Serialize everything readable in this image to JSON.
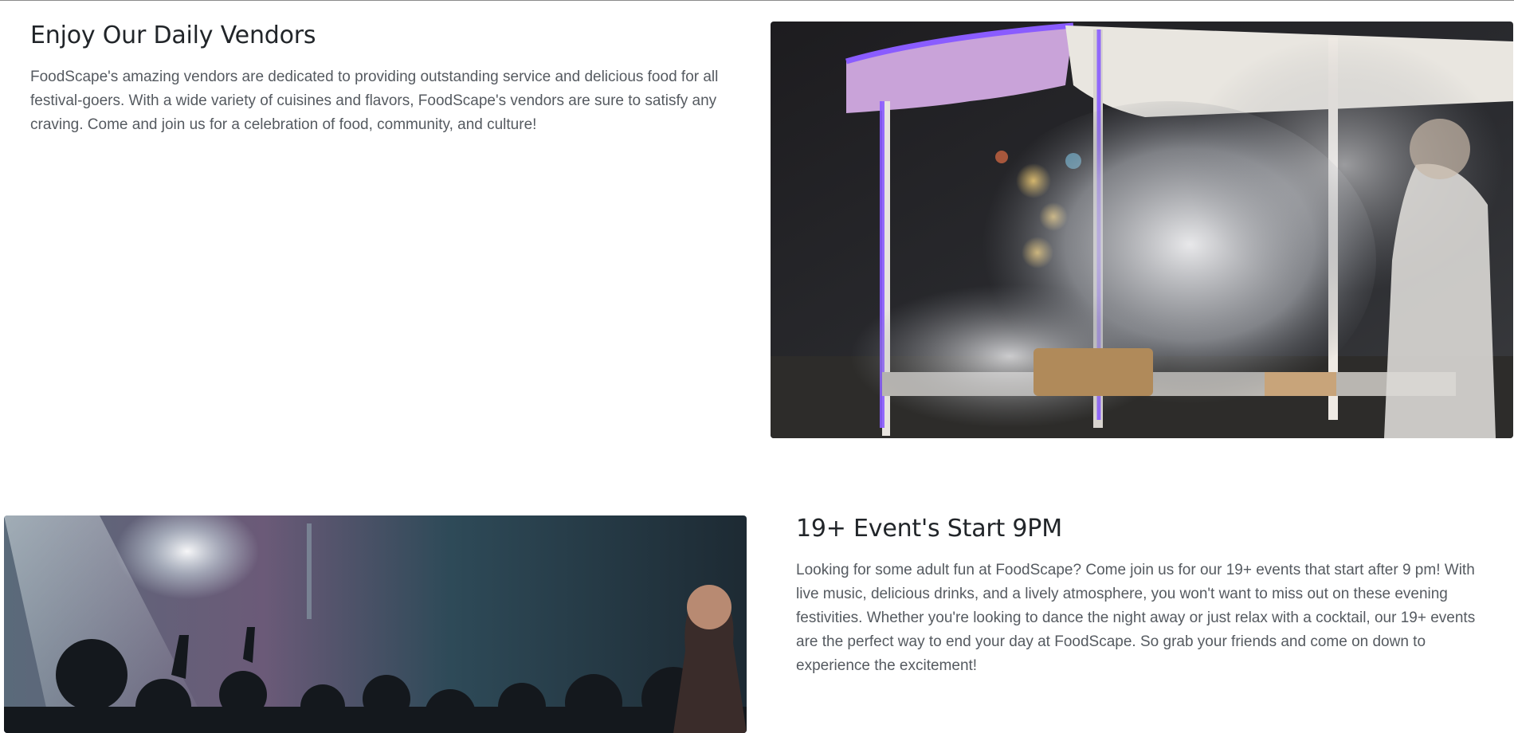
{
  "vendors": {
    "heading": "Enjoy Our Daily Vendors",
    "body": "FoodScape's amazing vendors are dedicated to providing outstanding service and delicious food for all festival-goers. With a wide variety of cuisines and flavors, FoodScape's vendors are sure to satisfy any craving. Come and join us for a celebration of food, community, and culture!",
    "image_icon": "food-cart-photo-icon"
  },
  "events": {
    "heading": "19+ Event's Start 9PM",
    "body": "Looking for some adult fun at FoodScape? Come join us for our 19+ events that start after 9 pm! With live music, delicious drinks, and a lively atmosphere, you won't want to miss out on these evening festivities. Whether you're looking to dance the night away or just relax with a cocktail, our 19+ events are the perfect way to end your day at FoodScape. So grab your friends and come on down to experience the excitement!",
    "image_icon": "concert-crowd-photo-icon"
  },
  "colors": {
    "heading": "#212529",
    "body": "#555a60",
    "accent_neon": "#8a5cff"
  }
}
